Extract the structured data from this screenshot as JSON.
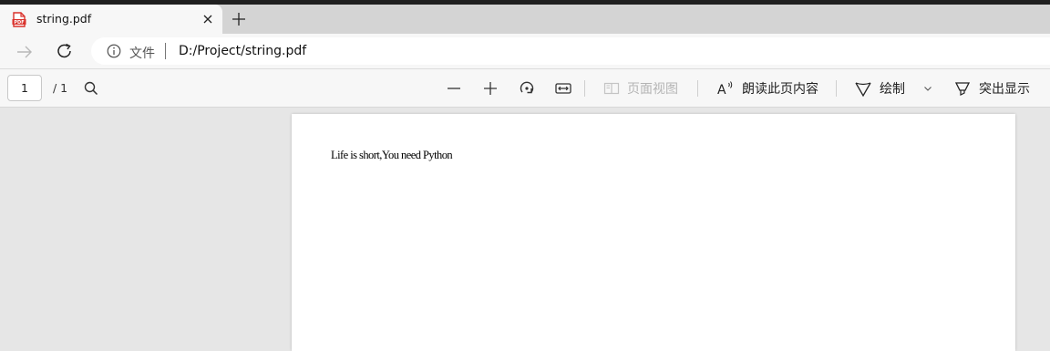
{
  "tab": {
    "title": "string.pdf",
    "icon": "pdf-file-icon"
  },
  "address": {
    "label": "文件",
    "url": "D:/Project/string.pdf"
  },
  "pdf_toolbar": {
    "page_number": "1",
    "page_total": "/ 1",
    "page_view_label": "页面视图",
    "read_aloud_label": "朗读此页内容",
    "draw_label": "绘制",
    "highlight_label": "突出显示"
  },
  "document": {
    "text": "Life is short,You need Python"
  },
  "colors": {
    "tab_strip": "#d4d4d4",
    "toolbar": "#f7f7f7",
    "viewer_background": "#e6e6e6",
    "pdf_icon_red": "#d9302a",
    "disabled_text": "#b4b4b4"
  }
}
